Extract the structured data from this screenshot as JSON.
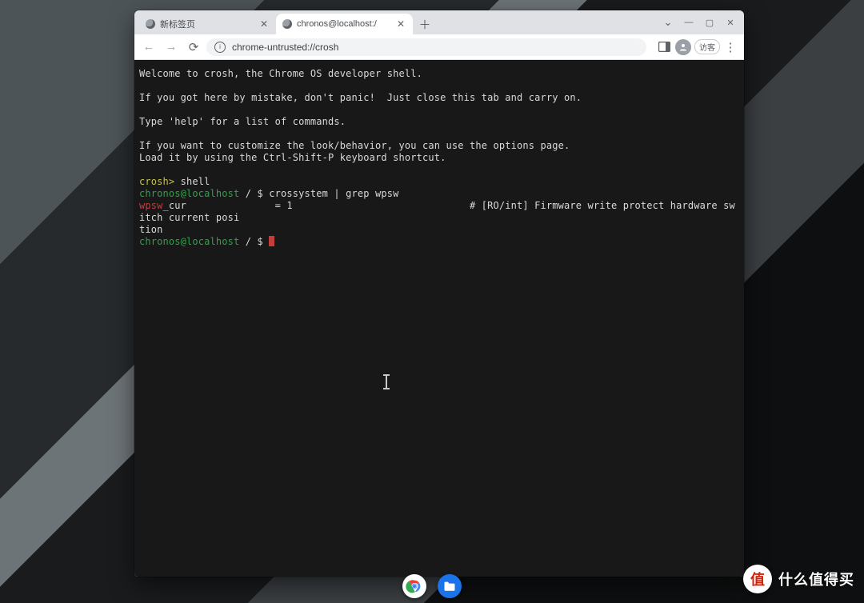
{
  "tabs": [
    {
      "title": "新标签页",
      "active": false
    },
    {
      "title": "chronos@localhost:/",
      "active": true
    }
  ],
  "omnibox": {
    "url": "chrome-untrusted://crosh"
  },
  "profile_label": "访客",
  "terminal": {
    "intro": [
      "Welcome to crosh, the Chrome OS developer shell.",
      "",
      "If you got here by mistake, don't panic!  Just close this tab and carry on.",
      "",
      "Type 'help' for a list of commands.",
      "",
      "If you want to customize the look/behavior, you can use the options page.",
      "Load it by using the Ctrl-Shift-P keyboard shortcut."
    ],
    "crosh_prompt": "crosh>",
    "crosh_cmd": " shell",
    "user_prompt": "chronos@localhost",
    "path_prompt": " / $ ",
    "cmd1": "crossystem | grep wpsw",
    "out_match": "wpsw",
    "out_rest1": "_cur               = 1                              # [RO/int] Firmware write protect hardware switch current posi",
    "out_rest2": "tion"
  },
  "watermark": {
    "badge": "值",
    "text": "什么值得买"
  }
}
